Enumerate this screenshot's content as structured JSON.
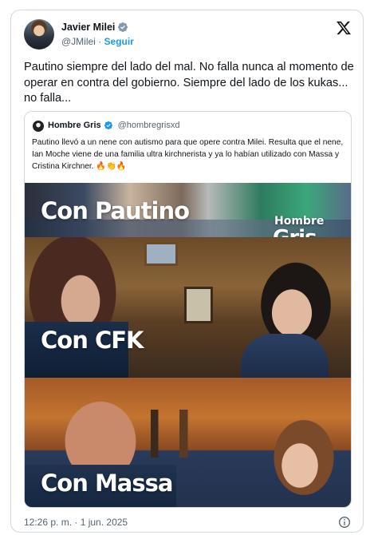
{
  "tweet": {
    "author_name": "Javier Milei",
    "handle": "@JMilei",
    "separator": " · ",
    "follow_label": "Seguir",
    "text": "Pautino siempre del lado del mal. No falla nunca al momento de operar en contra del gobierno. Siempre del lado de los kukas... no falla...",
    "timestamp": "12:26 p. m. · 1 jun. 2025"
  },
  "quote": {
    "author_name": "Hombre Gris",
    "handle": "@hombregrisxd",
    "text": "Pautino llevó a un nene con autismo para  que opere contra Milei. Resulta que el nene, Ian Moche viene de una familia ultra kirchnerista y ya lo habían utilizado con Massa y Cristina Kirchner. 🔥👏🔥",
    "media_captions": {
      "panel1": "Con Pautino",
      "panel1_watermark_top": "Hombre",
      "panel1_watermark_bottom": "Gris",
      "panel2": "Con CFK",
      "panel3": "Con Massa"
    }
  },
  "icons": {
    "verified": "verified-badge-icon",
    "x_logo": "x-logo-icon",
    "info": "info-icon"
  },
  "colors": {
    "accent": "#1d9bf0",
    "secondary_text": "#536471",
    "border": "#cfd9de"
  }
}
